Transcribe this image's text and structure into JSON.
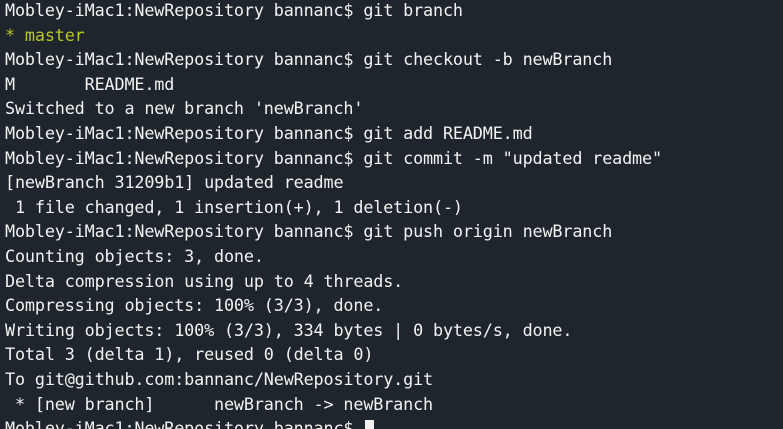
{
  "terminal": {
    "lines": [
      {
        "text": "Mobley-iMac1:NewRepository bannanc$ git branch",
        "color": "#f2f2f2"
      },
      {
        "text": "* master",
        "color": "#b9c62a"
      },
      {
        "text": "Mobley-iMac1:NewRepository bannanc$ git checkout -b newBranch",
        "color": "#f2f2f2"
      },
      {
        "text": "M       README.md",
        "color": "#f2f2f2"
      },
      {
        "text": "Switched to a new branch 'newBranch'",
        "color": "#f2f2f2"
      },
      {
        "text": "Mobley-iMac1:NewRepository bannanc$ git add README.md",
        "color": "#f2f2f2"
      },
      {
        "text": "Mobley-iMac1:NewRepository bannanc$ git commit -m \"updated readme\"",
        "color": "#f2f2f2"
      },
      {
        "text": "[newBranch 31209b1] updated readme",
        "color": "#f2f2f2"
      },
      {
        "text": " 1 file changed, 1 insertion(+), 1 deletion(-)",
        "color": "#f2f2f2"
      },
      {
        "text": "Mobley-iMac1:NewRepository bannanc$ git push origin newBranch",
        "color": "#f2f2f2"
      },
      {
        "text": "Counting objects: 3, done.",
        "color": "#f2f2f2"
      },
      {
        "text": "Delta compression using up to 4 threads.",
        "color": "#f2f2f2"
      },
      {
        "text": "Compressing objects: 100% (3/3), done.",
        "color": "#f2f2f2"
      },
      {
        "text": "Writing objects: 100% (3/3), 334 bytes | 0 bytes/s, done.",
        "color": "#f2f2f2"
      },
      {
        "text": "Total 3 (delta 1), reused 0 (delta 0)",
        "color": "#f2f2f2"
      },
      {
        "text": "To git@github.com:bannanc/NewRepository.git",
        "color": "#f2f2f2"
      },
      {
        "text": " * [new branch]      newBranch -> newBranch",
        "color": "#f2f2f2"
      }
    ],
    "prompt": "Mobley-iMac1:NewRepository bannanc$ "
  },
  "colors": {
    "background": "#1f252c",
    "text": "#f2f2f2",
    "branch_highlight": "#b9c62a"
  }
}
